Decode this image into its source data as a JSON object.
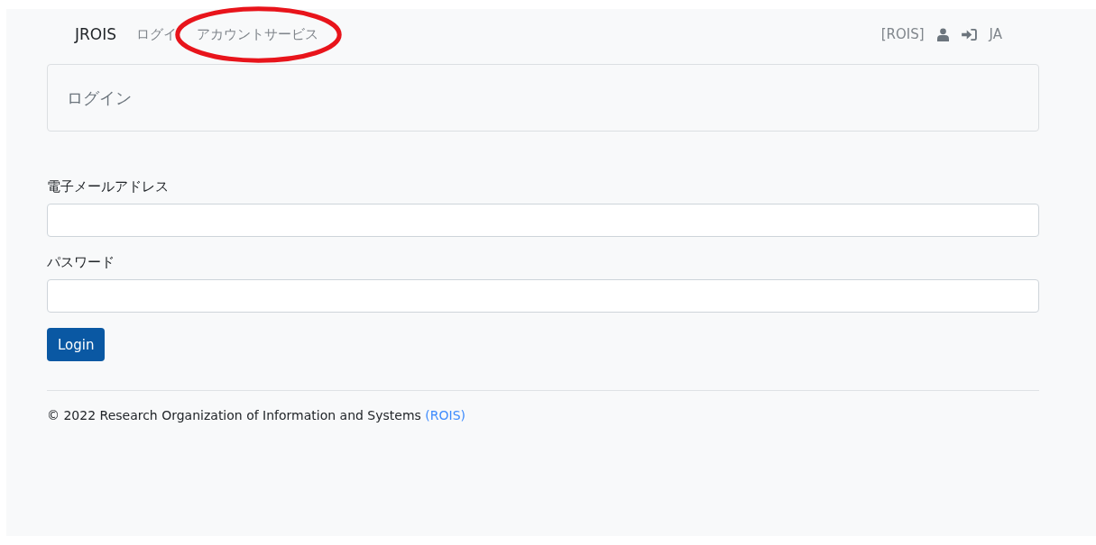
{
  "navbar": {
    "brand": "JROIS",
    "nav_items": [
      {
        "label": "ログイ"
      },
      {
        "label": "アカウントサービス"
      }
    ],
    "realm": "[ROIS]",
    "language": "JA"
  },
  "annotation": {
    "kind": "ellipse",
    "color": "#e8141b"
  },
  "header_card": {
    "title": "ログイン"
  },
  "form": {
    "fields": [
      {
        "label": "電子メールアドレス"
      },
      {
        "label": "パスワード"
      }
    ],
    "submit": "Login"
  },
  "footer": {
    "text": "© 2022 Research Organization of Information and Systems",
    "link": "(ROIS)"
  }
}
